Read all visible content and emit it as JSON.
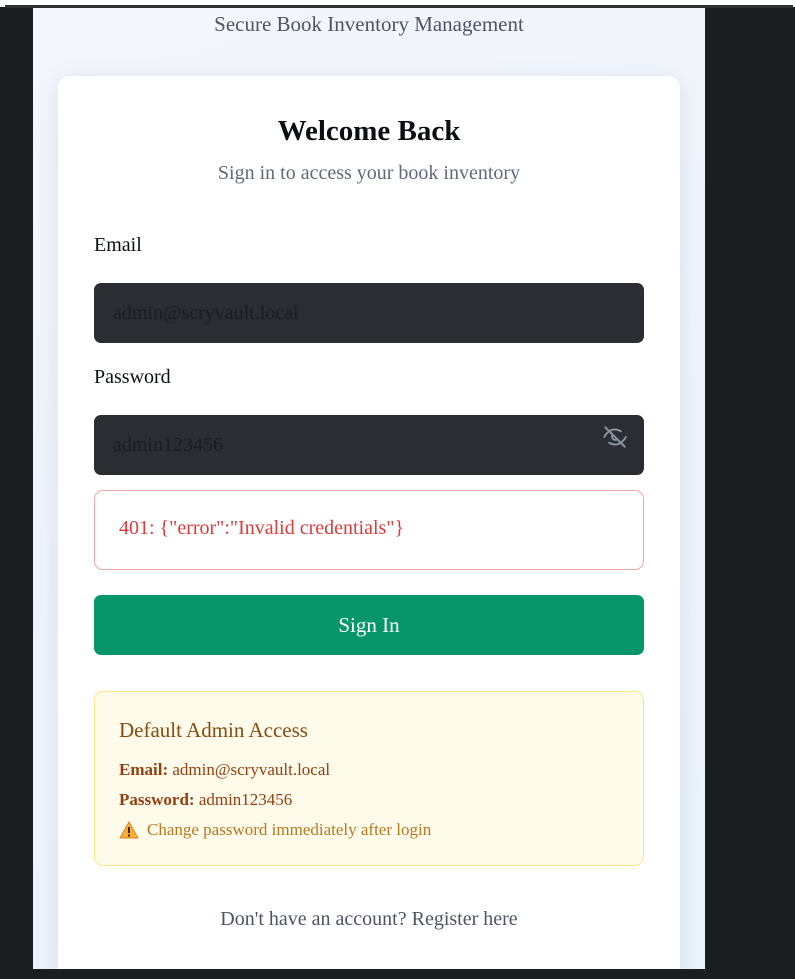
{
  "app": {
    "subtitle": "Secure Book Inventory Management"
  },
  "login": {
    "title": "Welcome Back",
    "lead": "Sign in to access your book inventory",
    "email_label": "Email",
    "email_value": "admin@scryvault.local",
    "password_label": "Password",
    "password_value": "admin123456",
    "password_toggle_icon": "eye-off-icon",
    "error_message": "401: {\"error\":\"Invalid credentials\"}",
    "submit_label": "Sign In"
  },
  "admin_notice": {
    "title": "Default Admin Access",
    "email_key": "Email:",
    "email_value": "admin@scryvault.local",
    "password_key": "Password:",
    "password_value": "admin123456",
    "warning_icon": "warning-icon",
    "warning_text": "Change password immediately after login"
  },
  "footer": {
    "prompt": "Don't have an account?",
    "link": "Register here"
  },
  "colors": {
    "primary_button": "#079669",
    "error": "#dc3b3b",
    "warning_bg": "#fffbeb",
    "field_bg": "#2a2d31"
  }
}
